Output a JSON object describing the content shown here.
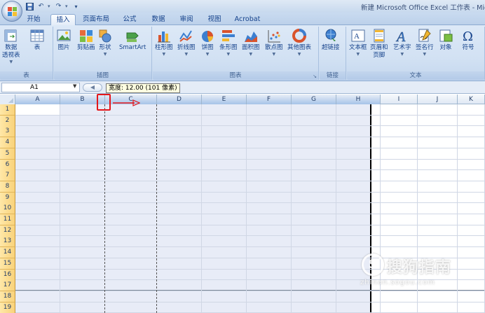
{
  "window_title": "新建 Microsoft Office Excel 工作表 - Micr",
  "qat": {
    "save_icon": "save-icon",
    "undo_icon": "undo-icon",
    "redo_icon": "redo-icon",
    "customize_icon": "customize-qat-icon"
  },
  "tabs": [
    {
      "label": "开始",
      "active": false
    },
    {
      "label": "插入",
      "active": true
    },
    {
      "label": "页面布局",
      "active": false
    },
    {
      "label": "公式",
      "active": false
    },
    {
      "label": "数据",
      "active": false
    },
    {
      "label": "审阅",
      "active": false
    },
    {
      "label": "视图",
      "active": false
    },
    {
      "label": "Acrobat",
      "active": false
    }
  ],
  "ribbon": {
    "groups": [
      {
        "label": "表",
        "buttons": [
          {
            "label": "数据",
            "label2": "透视表",
            "icon": "pivot-table-icon",
            "dropdown": true
          },
          {
            "label": "表",
            "icon": "table-icon"
          }
        ]
      },
      {
        "label": "插图",
        "buttons": [
          {
            "label": "图片",
            "icon": "picture-icon"
          },
          {
            "label": "剪贴画",
            "icon": "clip-art-icon"
          },
          {
            "label": "形状",
            "icon": "shapes-icon",
            "dropdown": true
          },
          {
            "label": "SmartArt",
            "icon": "smartart-icon"
          }
        ]
      },
      {
        "label": "图表",
        "buttons": [
          {
            "label": "柱形图",
            "icon": "column-chart-icon",
            "dropdown": true
          },
          {
            "label": "折线图",
            "icon": "line-chart-icon",
            "dropdown": true
          },
          {
            "label": "饼图",
            "icon": "pie-chart-icon",
            "dropdown": true
          },
          {
            "label": "条形图",
            "icon": "bar-chart-icon",
            "dropdown": true
          },
          {
            "label": "面积图",
            "icon": "area-chart-icon",
            "dropdown": true
          },
          {
            "label": "散点图",
            "icon": "scatter-chart-icon",
            "dropdown": true
          },
          {
            "label": "其他图表",
            "icon": "other-charts-icon",
            "dropdown": true
          }
        ]
      },
      {
        "label": "链接",
        "buttons": [
          {
            "label": "超链接",
            "icon": "hyperlink-icon"
          }
        ]
      },
      {
        "label": "文本",
        "buttons": [
          {
            "label": "文本框",
            "icon": "text-box-icon",
            "dropdown": true
          },
          {
            "label": "页眉和",
            "label2": "页脚",
            "icon": "header-footer-icon"
          },
          {
            "label": "艺术字",
            "icon": "wordart-icon",
            "dropdown": true
          },
          {
            "label": "签名行",
            "icon": "signature-line-icon",
            "dropdown": true
          },
          {
            "label": "对象",
            "icon": "object-icon"
          },
          {
            "label": "符号",
            "icon": "symbol-icon"
          }
        ]
      }
    ]
  },
  "formula_bar": {
    "name_box": "A1",
    "fx_icon": "fx-icon"
  },
  "tooltip": "宽度: 12.00 (101 像素)",
  "grid": {
    "columns": [
      "A",
      "B",
      "C",
      "D",
      "E",
      "F",
      "G",
      "H",
      "I",
      "J",
      "K"
    ],
    "selected_columns": [
      "A",
      "B",
      "C",
      "D",
      "E",
      "F",
      "G",
      "H"
    ],
    "rows": [
      "1",
      "2",
      "3",
      "4",
      "5",
      "6",
      "7",
      "8",
      "9",
      "10",
      "11",
      "12",
      "13",
      "14",
      "15",
      "16",
      "17",
      "18",
      "19"
    ],
    "active_cell": "A1"
  },
  "watermark": {
    "main": "搜狗指南",
    "sub": "zhinan.sogou.com",
    "logo": "S"
  },
  "colors": {
    "ribbon_bg": "#d2e1f3",
    "tab_text": "#15428b",
    "row_header_selected": "#f9d27a",
    "highlight": "#e4171b"
  }
}
